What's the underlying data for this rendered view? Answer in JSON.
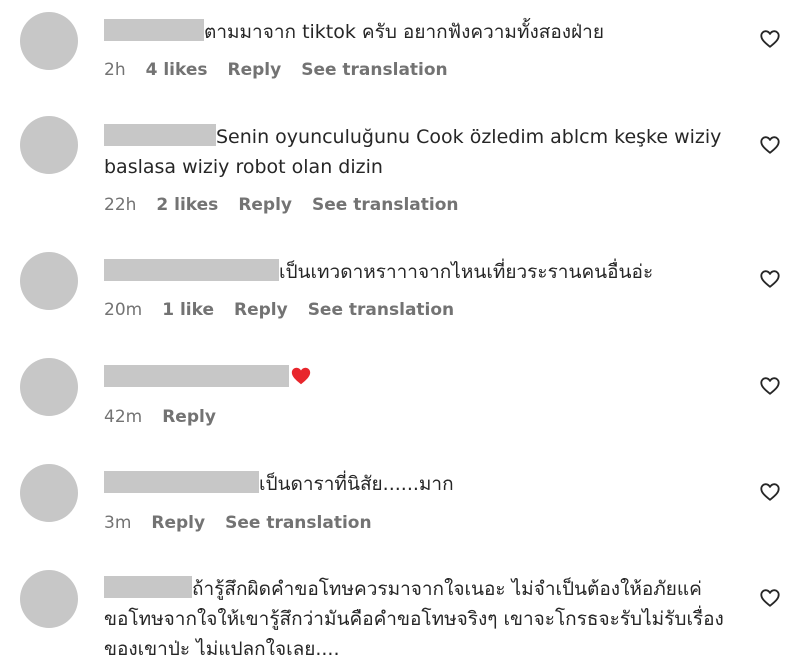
{
  "comments": [
    {
      "text": "ตามมาจาก tiktok ครับ อยากฟังความทั้งสองฝ่าย",
      "time": "2h",
      "likes": "4 likes",
      "reply": "Reply",
      "translate": "See translation"
    },
    {
      "text": "Senin oyunculuğunu Cook özledim ablcm keşke wiziy baslasa wiziy robot olan dizin",
      "time": "22h",
      "likes": "2 likes",
      "reply": "Reply",
      "translate": "See translation"
    },
    {
      "text": "เป็นเทวดาหราาาจากไหนเที่ยวระรานคนอื่นอ่ะ",
      "time": "20m",
      "likes": "1 like",
      "reply": "Reply",
      "translate": "See translation"
    },
    {
      "text": "",
      "time": "42m",
      "reply": "Reply"
    },
    {
      "text": "เป็นดาราที่นิสัย......มาก",
      "time": "3m",
      "reply": "Reply",
      "translate": "See translation"
    },
    {
      "text": "ถ้ารู้สึกผิดคำขอโทษควรมาจากใจเนอะ ไม่จำเป็นต้องให้อภัยแค่ขอโทษจากใจให้เขารู้สึกว่ามันคือคำขอโทษจริงๆ เขาจะโกรธจะรับไม่รับเรื่องของเขาป่ะ ไม่แปลกใจเลย....",
      "time": "",
      "reply": ""
    }
  ],
  "icons": {
    "like": "heart-outline-icon",
    "reaction": "red-heart-emoji"
  },
  "colors": {
    "avatar": "#c7c7c7",
    "meta": "#737373",
    "text": "#262626",
    "heart_red": "#e8262c"
  }
}
